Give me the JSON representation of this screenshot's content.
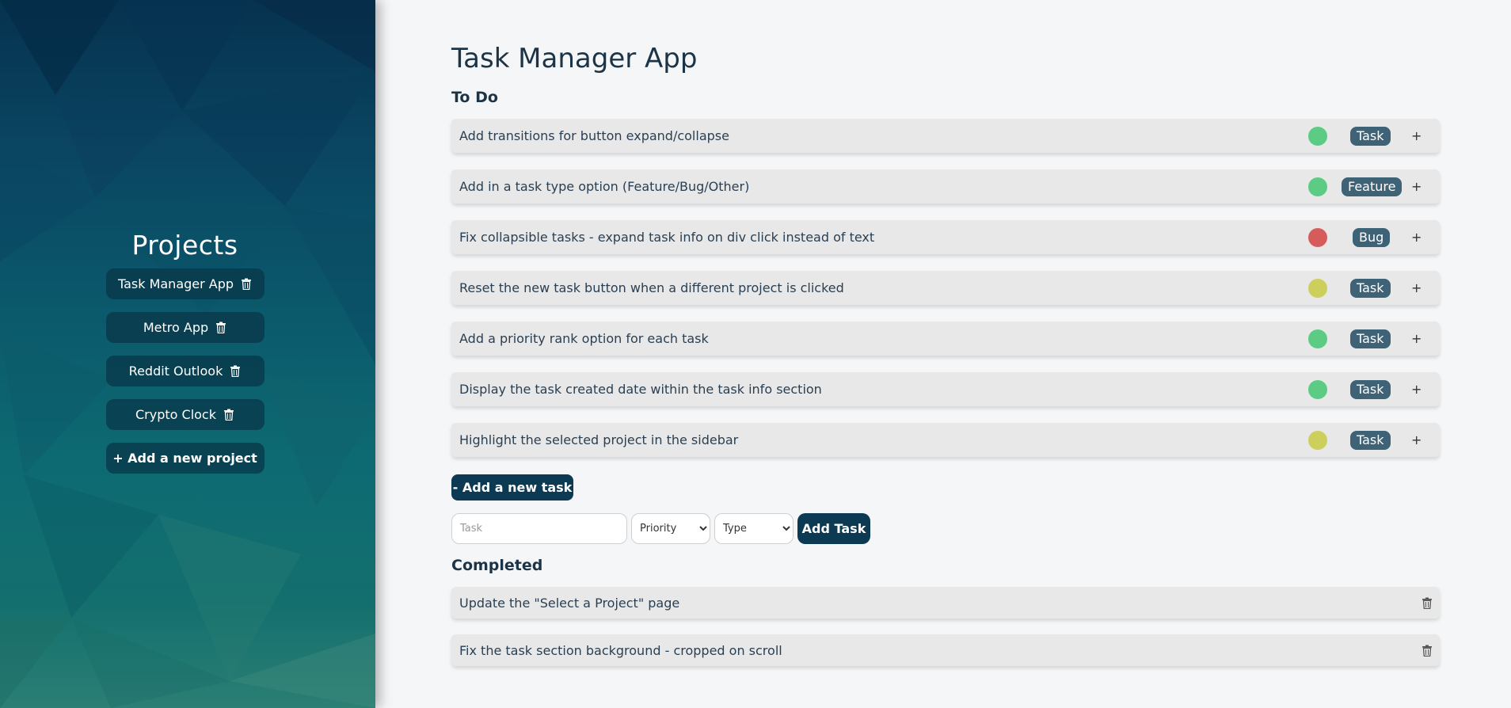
{
  "sidebar": {
    "title": "Projects",
    "projects": [
      {
        "label": "Task Manager App",
        "icon": "trash-icon"
      },
      {
        "label": "Metro App",
        "icon": "trash-icon"
      },
      {
        "label": "Reddit Outlook",
        "icon": "trash-icon"
      },
      {
        "label": "Crypto Clock",
        "icon": "trash-icon"
      }
    ],
    "add_project_label": "+ Add a new project"
  },
  "main": {
    "title": "Task Manager App",
    "todo_title": "To Do",
    "tasks": [
      {
        "text": "Add transitions for button expand/collapse",
        "priority_color": "#5ccb84",
        "type": "Task",
        "expand": "+"
      },
      {
        "text": "Add in a task type option (Feature/Bug/Other)",
        "priority_color": "#5ccb84",
        "type": "Feature",
        "expand": "+"
      },
      {
        "text": "Fix collapsible tasks - expand task info on div click instead of text",
        "priority_color": "#d65b5b",
        "type": "Bug",
        "expand": "+"
      },
      {
        "text": "Reset the new task button when a different project is clicked",
        "priority_color": "#cdcf5c",
        "type": "Task",
        "expand": "+"
      },
      {
        "text": "Add a priority rank option for each task",
        "priority_color": "#5ccb84",
        "type": "Task",
        "expand": "+"
      },
      {
        "text": "Display the task created date within the task info section",
        "priority_color": "#5ccb84",
        "type": "Task",
        "expand": "+"
      },
      {
        "text": "Highlight the selected project in the sidebar",
        "priority_color": "#cdcf5c",
        "type": "Task",
        "expand": "+"
      }
    ],
    "toggle_form_label": "- Add a new task",
    "form": {
      "task_placeholder": "Task",
      "priority_label": "Priority",
      "type_label": "Type",
      "add_label": "Add Task"
    },
    "completed_title": "Completed",
    "completed": [
      {
        "text": "Update the \"Select a Project\" page",
        "icon": "trash-icon"
      },
      {
        "text": "Fix the task section background - cropped on scroll",
        "icon": "trash-icon"
      }
    ]
  },
  "colors": {
    "accent": "#0b3a52",
    "badge": "#3e6276",
    "row_bg": "#e8e8e8",
    "page_bg": "#f4f6f8",
    "priority_green": "#5ccb84",
    "priority_red": "#d65b5b",
    "priority_yellow": "#cdcf5c"
  }
}
